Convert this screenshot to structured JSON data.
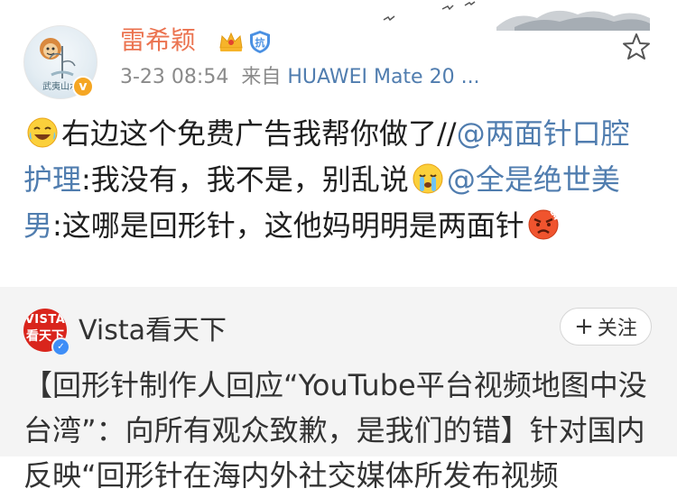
{
  "post": {
    "username": "雷希颖",
    "timestamp": "3-23 08:54",
    "source_prefix": "来自",
    "source_device": "HUAWEI Mate 20 ...",
    "avatar_caption": "武夷山水",
    "avatar_badge": "v",
    "content": {
      "part1": "右边这个免费广告我帮你做了//",
      "mention1": "@两面针口腔护理",
      "part2": ":我没有，我不是，别乱说",
      "mention2": "@全是绝世美男",
      "part3": ":这哪是回形针，这他妈明明是两面针"
    },
    "icons": [
      "laughing-tears-emoji",
      "vip-crown-icon",
      "anti-virus-shield-icon",
      "star-icon",
      "crying-emoji",
      "angry-emoji"
    ]
  },
  "repost": {
    "author": "Vista看天下",
    "avatar_line1": "VISTA",
    "avatar_line2": "看天下",
    "follow_label": "关注",
    "follow_plus": "+",
    "text": "【回形针制作人回应“YouTube平台视频地图中没台湾”：向所有观众致歉，是我们的错】针对国内反映“回形针在海内外社交媒体所发布视频"
  },
  "colors": {
    "username": "#eb7350",
    "link": "#507daf",
    "meta": "#8a8a8a",
    "repost_bg": "#f4f4f4",
    "verified": "#3e8ef7"
  }
}
